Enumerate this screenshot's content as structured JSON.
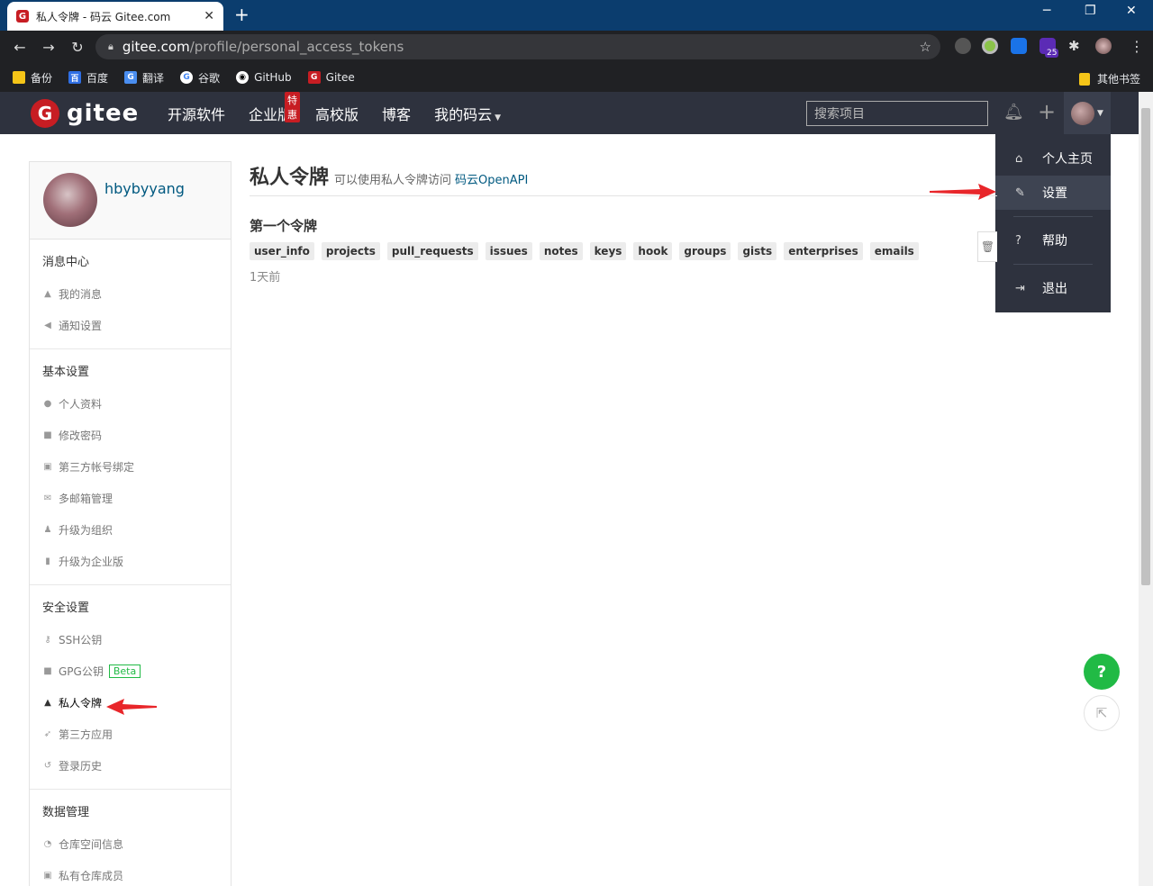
{
  "browser": {
    "tab_title": "私人令牌 - 码云 Gitee.com",
    "tab_close": "✕",
    "new_tab": "+",
    "url_host": "gitee.com",
    "url_path": "/profile/personal_access_tokens",
    "extension_badge": "25",
    "bookmarks": [
      "备份",
      "百度",
      "翻译",
      "谷歌",
      "GitHub",
      "Gitee"
    ],
    "other_bookmarks": "其他书签"
  },
  "header": {
    "logo_text": "gitee",
    "nav": [
      "开源软件",
      "企业版",
      "高校版",
      "博客",
      "我的码云"
    ],
    "enterprise_badge": "特惠",
    "search_placeholder": "搜索项目"
  },
  "dropdown": {
    "items": [
      "个人主页",
      "设置",
      "帮助",
      "退出"
    ],
    "active": "设置"
  },
  "sidebar": {
    "username": "hbybyyang",
    "sections": [
      {
        "title": "消息中心",
        "items": [
          "我的消息",
          "通知设置"
        ]
      },
      {
        "title": "基本设置",
        "items": [
          "个人资料",
          "修改密码",
          "第三方帐号绑定",
          "多邮箱管理",
          "升级为组织",
          "升级为企业版"
        ]
      },
      {
        "title": "安全设置",
        "items": [
          "SSH公钥",
          "GPG公钥",
          "私人令牌",
          "第三方应用",
          "登录历史"
        ],
        "beta": "Beta"
      },
      {
        "title": "数据管理",
        "items": [
          "仓库空间信息",
          "私有仓库成员"
        ]
      }
    ]
  },
  "main": {
    "title": "私人令牌",
    "desc": "可以使用私人令牌访问",
    "link": "码云OpenAPI",
    "token_name": "第一个令牌",
    "scopes": [
      "user_info",
      "projects",
      "pull_requests",
      "issues",
      "notes",
      "keys",
      "hook",
      "groups",
      "gists",
      "enterprises",
      "emails"
    ],
    "created": "1天前"
  },
  "fab": {
    "help": "?"
  },
  "colors": {
    "header_bg": "#2e323e",
    "brand_red": "#c71d23",
    "link": "#005980",
    "success": "#21ba45",
    "annotation_arrow": "#e8262a"
  }
}
